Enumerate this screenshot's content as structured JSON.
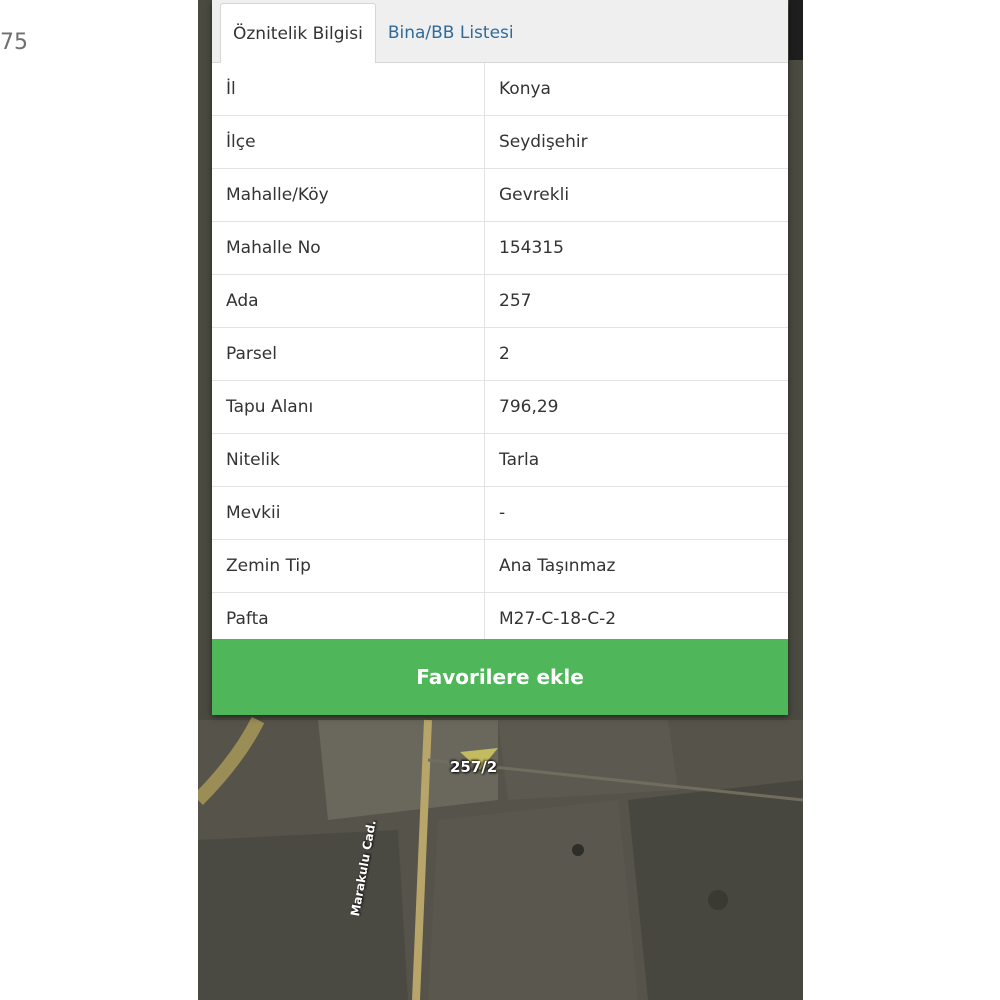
{
  "corner_text": "75",
  "tabs": [
    {
      "label": "Öznitelik Bilgisi"
    },
    {
      "label": "Bina/BB Listesi"
    }
  ],
  "rows": [
    {
      "key": "İl",
      "value": "Konya"
    },
    {
      "key": "İlçe",
      "value": "Seydişehir"
    },
    {
      "key": "Mahalle/Köy",
      "value": "Gevrekli"
    },
    {
      "key": "Mahalle No",
      "value": "154315"
    },
    {
      "key": "Ada",
      "value": "257"
    },
    {
      "key": "Parsel",
      "value": "2"
    },
    {
      "key": "Tapu Alanı",
      "value": "796,29"
    },
    {
      "key": "Nitelik",
      "value": "Tarla"
    },
    {
      "key": "Mevkii",
      "value": "-"
    },
    {
      "key": "Zemin Tip",
      "value": "Ana Taşınmaz"
    },
    {
      "key": "Pafta",
      "value": "M27-C-18-C-2"
    }
  ],
  "favorite_button": "Favorilere ekle",
  "map": {
    "parcel_label": "257/2",
    "road_label": "Marakulu Cad."
  },
  "colors": {
    "button_green": "#4fb75a",
    "tab_link_blue": "#2f6b9a"
  }
}
